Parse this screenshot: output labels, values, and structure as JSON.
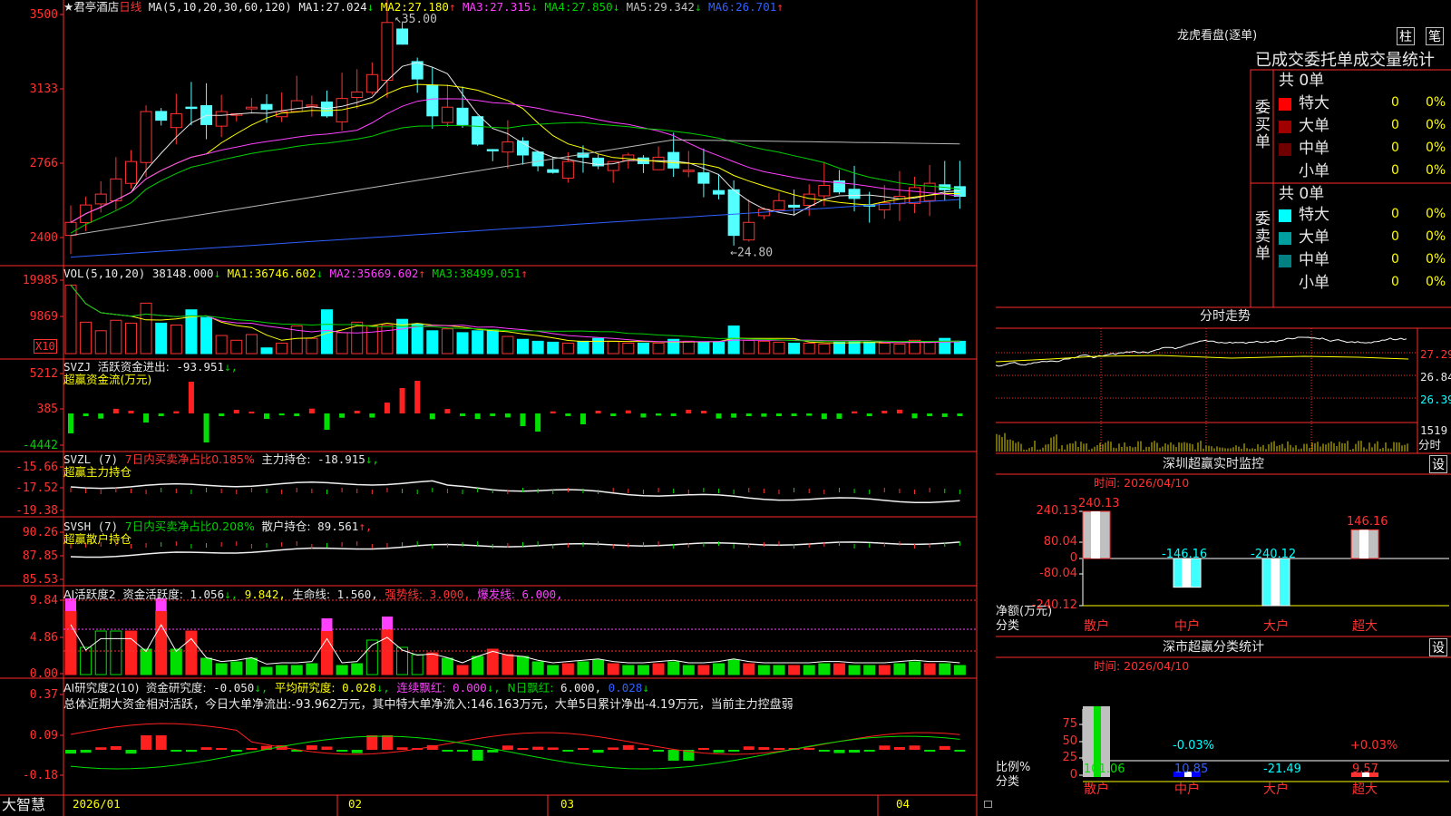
{
  "stock": {
    "name": "君亭酒店",
    "period": "日线",
    "star": "★"
  },
  "main": {
    "ma_params": "MA(5,10,20,30,60,120)",
    "ma": [
      {
        "label": "MA1:",
        "value": "27.024",
        "arrow": "↓",
        "color": "#e8e8e8"
      },
      {
        "label": "MA2:",
        "value": "27.180",
        "arrow": "↑",
        "color": "#ffff00"
      },
      {
        "label": "MA3:",
        "value": "27.315",
        "arrow": "↓",
        "color": "#ff40ff"
      },
      {
        "label": "MA4:",
        "value": "27.850",
        "arrow": "↓",
        "color": "#00d000"
      },
      {
        "label": "MA5:",
        "value": "29.342",
        "arrow": "↓",
        "color": "#c0c0c0"
      },
      {
        "label": "MA6:",
        "value": "26.701",
        "arrow": "↑",
        "color": "#3060ff"
      }
    ],
    "y_ticks": [
      "3500",
      "3133",
      "2766",
      "2400"
    ],
    "high_label": "35.00",
    "low_label": "24.80",
    "price_range": [
      23.9,
      35.5
    ]
  },
  "volume": {
    "params": "VOL(5,10,20)",
    "value": "38148.000",
    "arrow": "↓",
    "ma": [
      {
        "label": "MA1:",
        "value": "36746.602",
        "arrow": "↓",
        "color": "#ffff00"
      },
      {
        "label": "MA2:",
        "value": "35669.602",
        "arrow": "↑",
        "color": "#ff40ff"
      },
      {
        "label": "MA3:",
        "value": "38499.051",
        "arrow": "↑",
        "color": "#00d000"
      }
    ],
    "y_ticks": [
      "19985",
      "9869"
    ],
    "unit": "X10"
  },
  "svzj": {
    "name": "SVZJ",
    "title": "活跃资金进出:",
    "value": "-93.951",
    "arrow": "↓,",
    "sub": "超赢资金流(万元)",
    "y_ticks": [
      "5212",
      "385",
      "-4442"
    ]
  },
  "svzl": {
    "name": "SVZL (7)",
    "ratio_label": "7日内买卖净占比0.185%",
    "title": "主力持仓:",
    "value": "-18.915",
    "arrow": "↓,",
    "sub": "超赢主力持仓",
    "y_ticks": [
      "-15.66",
      "-17.52",
      "-19.38"
    ]
  },
  "svsh": {
    "name": "SVSH (7)",
    "ratio_label": "7日内买卖净占比0.208%",
    "title": "散户持仓:",
    "value": "89.561",
    "arrow": "↑,",
    "sub": "超赢散户持仓",
    "y_ticks": [
      "90.26",
      "87.85",
      "85.53"
    ]
  },
  "ai_active": {
    "name": "AI活跃度2",
    "title": "资金活跃度:",
    "value": "1.056",
    "arrow": "↓,",
    "v2": "9.842,",
    "life_label": "生命线:",
    "life_value": "1.560,",
    "strong_label": "强势线:",
    "strong_value": "3.000,",
    "burst_label": "爆发线:",
    "burst_value": "6.000,",
    "y_ticks": [
      "9.84",
      "4.86",
      "0.00"
    ]
  },
  "ai_research": {
    "name": "AI研究度2(10)",
    "title": "资金研究度:",
    "value": "-0.050",
    "arrow": "↓,",
    "avg_label": "平均研究度:",
    "avg_value": "0.028",
    "lian_label": "连续飘红:",
    "lian_value": "0.000",
    "n_label": "N日飘红:",
    "n_value": "6.000,",
    "extra": "0.028",
    "summary": "总体近期大资金相对活跃，今日大单净流出:-93.962万元，其中特大单净流入:146.163万元，大单5日累计净出-4.19万元，当前主力控盘弱",
    "y_ticks": [
      "0.37",
      "0.09",
      "-0.18"
    ]
  },
  "x_axis": {
    "labels": [
      "2026/01",
      "02",
      "03",
      "04"
    ]
  },
  "footer": {
    "brand": "大智慧"
  },
  "lhb": {
    "title": "龙虎看盘(逐单)",
    "btn_zhu": "柱",
    "btn_bi": "笔",
    "header": "已成交委托单成交量统计",
    "buy_label": "委买单",
    "sell_label": "委卖单",
    "buy_total": "共 0单",
    "sell_total": "共 0单",
    "buy_rows": [
      {
        "name": "特大",
        "count": "0",
        "pct": "0%",
        "color": "#ff0000"
      },
      {
        "name": "大单",
        "count": "0",
        "pct": "0%",
        "color": "#a00000"
      },
      {
        "name": "中单",
        "count": "0",
        "pct": "0%",
        "color": "#700000"
      },
      {
        "name": "小单",
        "count": "0",
        "pct": "0%",
        "color": ""
      }
    ],
    "sell_rows": [
      {
        "name": "特大",
        "count": "0",
        "pct": "0%",
        "color": "#00ffff"
      },
      {
        "name": "大单",
        "count": "0",
        "pct": "0%",
        "color": "#00a0a0"
      },
      {
        "name": "中单",
        "count": "0",
        "pct": "0%",
        "color": "#008080"
      },
      {
        "name": "小单",
        "count": "0",
        "pct": "0%",
        "color": ""
      }
    ]
  },
  "intraday": {
    "title": "分时走势",
    "y_ticks": [
      "27.29",
      "26.84",
      "26.39"
    ],
    "vol_label": "1519",
    "tag": "分时"
  },
  "sz_monitor": {
    "title": "深圳超赢实时监控",
    "btn": "设",
    "time": "时间: 2026/04/10",
    "y_ticks": [
      "240.13",
      "80.04",
      "0",
      "-80.04",
      "-240.12"
    ],
    "y_label": "净额(万元)",
    "cat_label": "分类",
    "categories": [
      "散户",
      "中户",
      "大户",
      "超大"
    ],
    "values": [
      240.13,
      -146.16,
      -240.12,
      146.16
    ],
    "value_labels": [
      "240.13",
      "-146.16",
      "-240.12",
      "146.16"
    ]
  },
  "sz_stats": {
    "title": "深市超赢分类统计",
    "btn": "设",
    "time": "时间: 2026/04/10",
    "y_ticks": [
      "75",
      "50",
      "25",
      "0"
    ],
    "y_label": "比例%",
    "cat_label": "分类",
    "categories": [
      "散户",
      "中户",
      "大户",
      "超大"
    ],
    "bottom_values": [
      "101.06",
      "10.85",
      "-21.49",
      "9.57"
    ],
    "top_labels": [
      "",
      "-0.03%",
      "",
      "+0.03%"
    ]
  },
  "chart_data": [
    {
      "type": "bar",
      "title": "深圳超赢实时监控",
      "categories": [
        "散户",
        "中户",
        "大户",
        "超大"
      ],
      "values": [
        240.13,
        -146.16,
        -240.12,
        146.16
      ],
      "ylabel": "净额(万元)",
      "ylim": [
        -240.12,
        240.13
      ]
    },
    {
      "type": "bar",
      "title": "深市超赢分类统计",
      "categories": [
        "散户",
        "中户",
        "大户",
        "超大"
      ],
      "values": [
        101.06,
        10.85,
        -21.49,
        9.57
      ],
      "ylabel": "比例%",
      "ylim": [
        0,
        75
      ]
    }
  ]
}
